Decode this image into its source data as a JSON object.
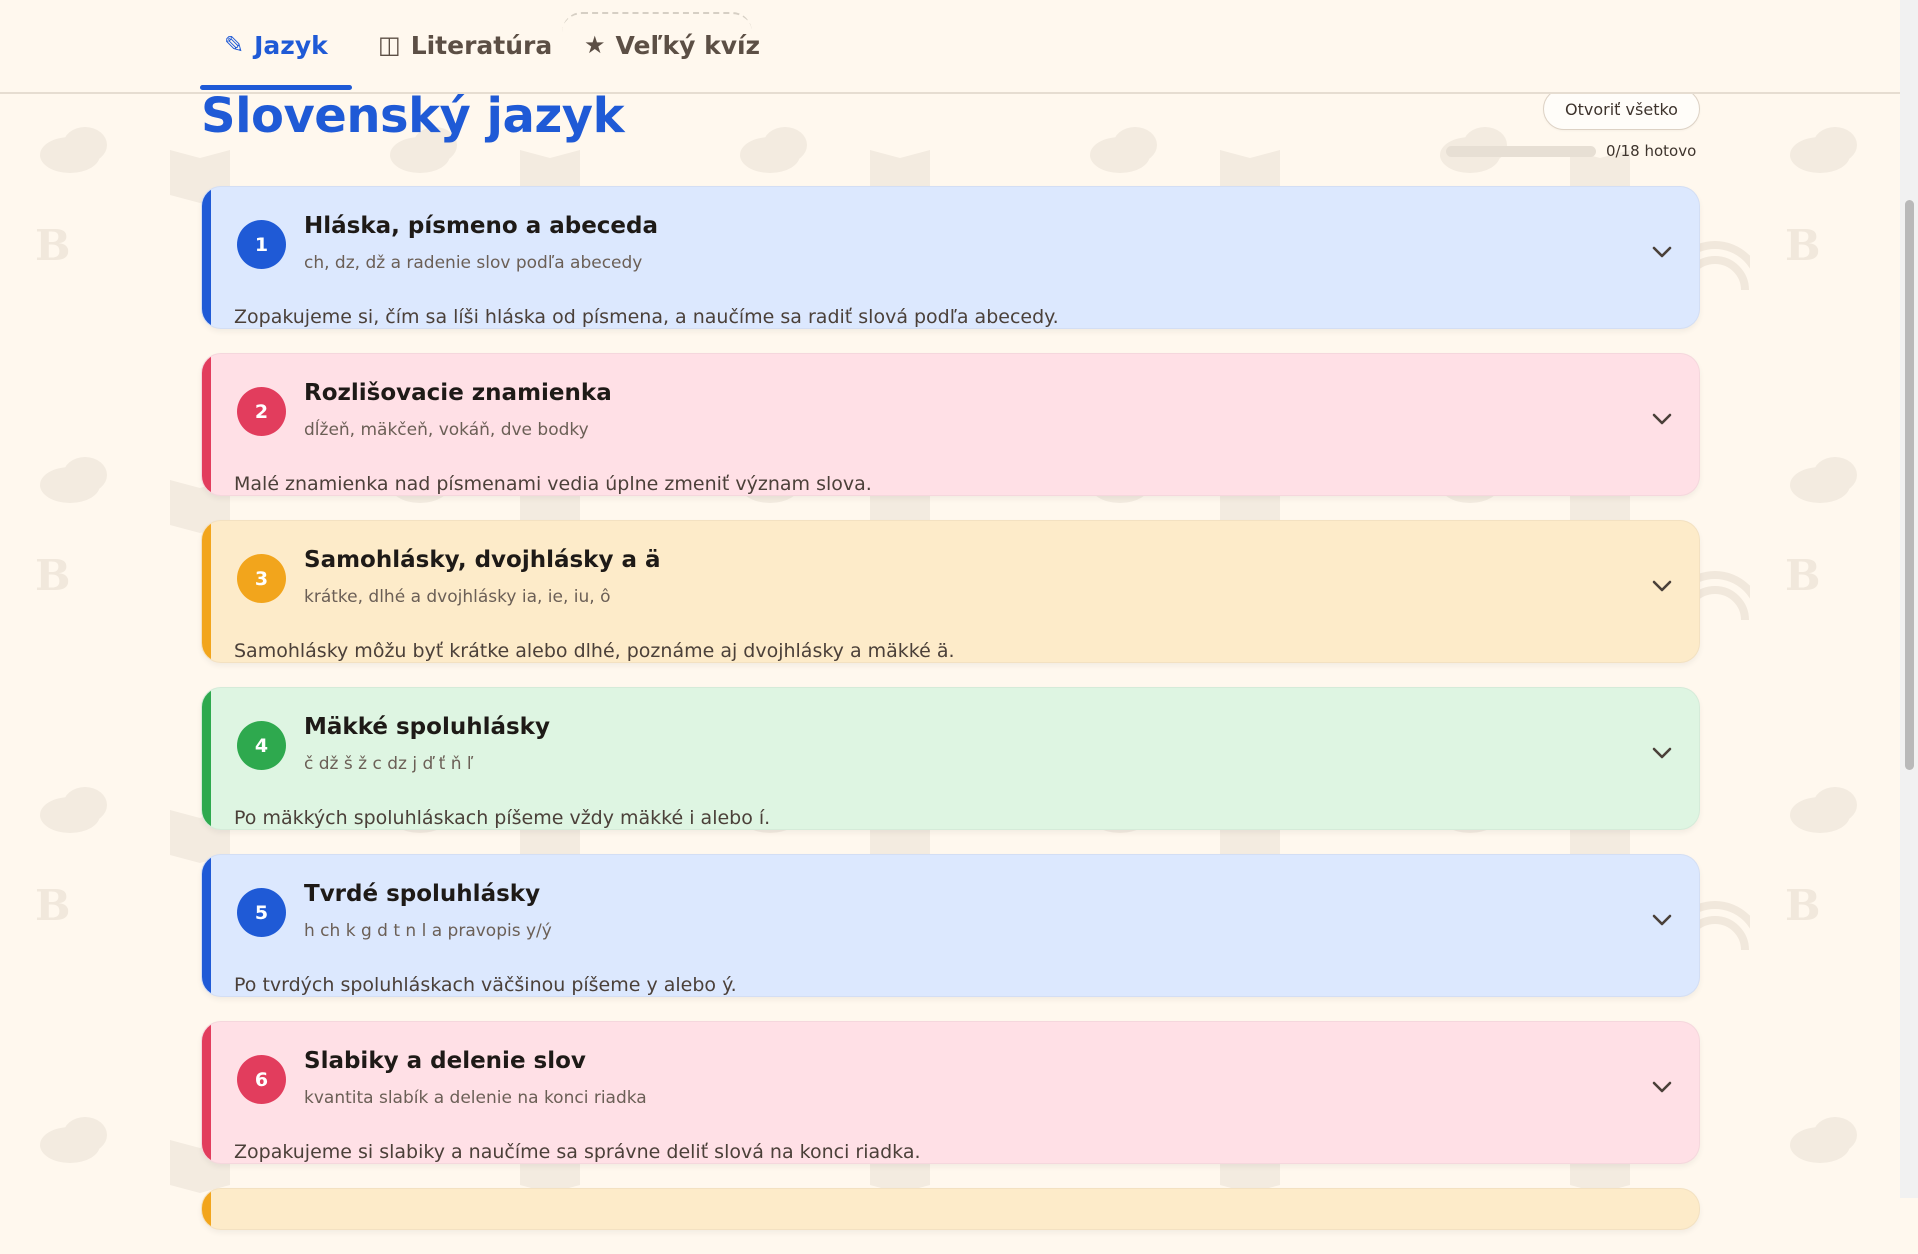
{
  "tabs": [
    {
      "label": "Jazyk",
      "icon": "pencil-icon",
      "glyph": "✎",
      "active": true
    },
    {
      "label": "Literatúra",
      "icon": "book-icon",
      "glyph": "◫",
      "active": false
    },
    {
      "label": "Veľký kvíz",
      "icon": "star-icon",
      "glyph": "★",
      "active": false
    }
  ],
  "header": {
    "title": "Slovenský jazyk",
    "open_all_label": "Otvoriť všetko",
    "progress_label": "0/18 hotovo",
    "progress_fraction": 0
  },
  "colors": {
    "accent": "#1f5ad6",
    "blue": "#1f5ad6",
    "red": "#e23d5d",
    "orange": "#f2a51c",
    "green": "#2ea94e"
  },
  "topics": [
    {
      "number": "1",
      "title": "Hláska, písmeno a abeceda",
      "subtitle": "ch, dz, dž a radenie slov podľa abecedy",
      "description": "Zopakujeme si, čím sa líši hláska od písmena, a naučíme sa radiť slová podľa abecedy.",
      "color": "blue"
    },
    {
      "number": "2",
      "title": "Rozlišovacie znamienka",
      "subtitle": "dĺžeň, mäkčeň, vokáň, dve bodky",
      "description": "Malé znamienka nad písmenami vedia úplne zmeniť význam slova.",
      "color": "red"
    },
    {
      "number": "3",
      "title": "Samohlásky, dvojhlásky a ä",
      "subtitle": "krátke, dlhé a dvojhlásky ia, ie, iu, ô",
      "description": "Samohlásky môžu byť krátke alebo dlhé, poznáme aj dvojhlásky a mäkké ä.",
      "color": "orange"
    },
    {
      "number": "4",
      "title": "Mäkké spoluhlásky",
      "subtitle": "č dž š ž c dz j ď ť ň ľ",
      "description": "Po mäkkých spoluhláskach píšeme vždy mäkké i alebo í.",
      "color": "green"
    },
    {
      "number": "5",
      "title": "Tvrdé spoluhlásky",
      "subtitle": "h ch k g d t n l a pravopis y/ý",
      "description": "Po tvrdých spoluhláskach väčšinou píšeme y alebo ý.",
      "color": "blue"
    },
    {
      "number": "6",
      "title": "Slabiky a delenie slov",
      "subtitle": "kvantita slabík a delenie na konci riadka",
      "description": "Zopakujeme si slabiky a naučíme sa správne deliť slová na konci riadka.",
      "color": "red"
    }
  ]
}
